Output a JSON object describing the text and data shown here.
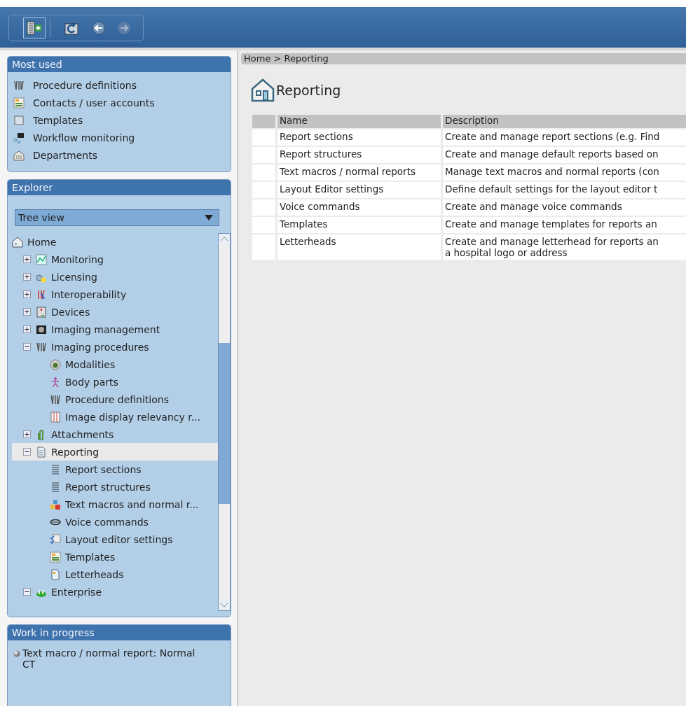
{
  "most_used": {
    "title": "Most used",
    "items": [
      {
        "label": "Procedure definitions"
      },
      {
        "label": "Contacts / user accounts"
      },
      {
        "label": "Templates"
      },
      {
        "label": "Workflow monitoring"
      },
      {
        "label": "Departments"
      }
    ]
  },
  "explorer": {
    "title": "Explorer",
    "view": "Tree view",
    "tree": [
      {
        "label": "Home",
        "selected": false
      },
      {
        "label": "Monitoring",
        "expanded": false,
        "selected": false
      },
      {
        "label": "Licensing",
        "expanded": false,
        "selected": false
      },
      {
        "label": "Interoperability",
        "expanded": false,
        "selected": false
      },
      {
        "label": "Devices",
        "expanded": false,
        "selected": false
      },
      {
        "label": "Imaging management",
        "expanded": false,
        "selected": false
      },
      {
        "label": "Imaging procedures",
        "expanded": true,
        "selected": false,
        "children": [
          {
            "label": "Modalities",
            "selected": false
          },
          {
            "label": "Body parts",
            "selected": false
          },
          {
            "label": "Procedure definitions",
            "selected": false
          },
          {
            "label": "Image display relevancy r...",
            "selected": false
          }
        ]
      },
      {
        "label": "Attachments",
        "expanded": false,
        "selected": false
      },
      {
        "label": "Reporting",
        "expanded": true,
        "selected": true,
        "children": [
          {
            "label": "Report sections",
            "selected": false
          },
          {
            "label": "Report structures",
            "selected": false
          },
          {
            "label": "Text macros and normal r...",
            "selected": false
          },
          {
            "label": "Voice commands",
            "selected": false
          },
          {
            "label": "Layout editor settings",
            "selected": false
          },
          {
            "label": "Templates",
            "selected": false
          },
          {
            "label": "Letterheads",
            "selected": false
          }
        ]
      },
      {
        "label": "Enterprise",
        "expanded": true,
        "selected": false
      }
    ]
  },
  "work_in_progress": {
    "title": "Work in progress",
    "items": [
      "Text macro / normal report: Normal CT"
    ]
  },
  "breadcrumb": "Home > Reporting",
  "page_title": "Reporting",
  "table": {
    "columns": [
      "Name",
      "Description"
    ],
    "rows": [
      {
        "name": "Report sections",
        "description": [
          "Create and manage report sections (e.g. Find"
        ]
      },
      {
        "name": "Report structures",
        "description": [
          "Create and manage default reports based on"
        ]
      },
      {
        "name": "Text macros / normal reports",
        "description": [
          "Manage text macros and normal reports (con"
        ]
      },
      {
        "name": "Layout Editor settings",
        "description": [
          "Define default settings for the layout editor t"
        ]
      },
      {
        "name": "Voice commands",
        "description": [
          "Create and manage voice commands"
        ]
      },
      {
        "name": "Templates",
        "description": [
          "Create and manage templates for reports an"
        ]
      },
      {
        "name": "Letterheads",
        "description": [
          "Create and manage letterhead for reports an",
          "a hospital logo or address"
        ]
      }
    ]
  }
}
